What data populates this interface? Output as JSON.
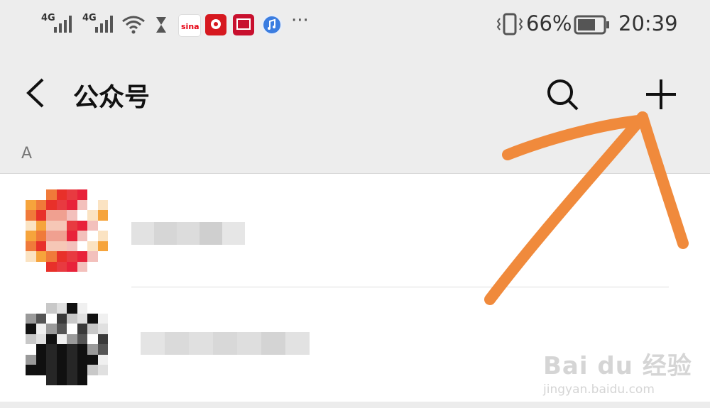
{
  "status_bar": {
    "signal_1_label": "4G",
    "signal_2_label": "4G",
    "more_indicator": "···",
    "battery_percent": "66%",
    "time": "20:39",
    "apps": [
      "sina-icon",
      "huawei-icon",
      "netease-icon",
      "music-icon"
    ]
  },
  "nav": {
    "title": "公众号"
  },
  "section": {
    "letter": "A"
  },
  "list": {
    "items": [
      {
        "name": "",
        "avatar": "red-orange-pixelated-avatar"
      },
      {
        "name": "",
        "avatar": "black-white-pixelated-avatar"
      }
    ]
  },
  "watermark": {
    "brand": "Bai du 经验",
    "url": "jingyan.baidu.com"
  },
  "colors": {
    "bar_bg": "#ededed",
    "annotation_arrow": "#f08a3c"
  }
}
